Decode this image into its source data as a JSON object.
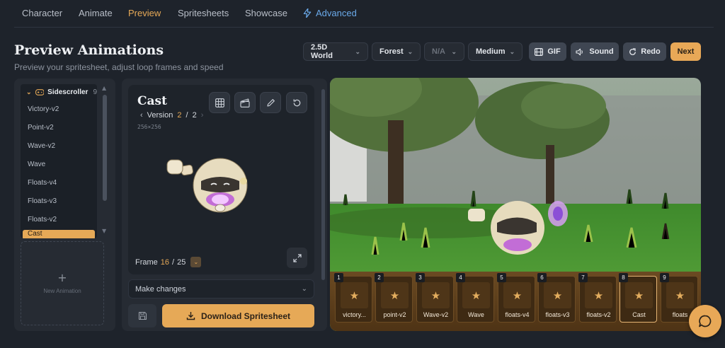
{
  "nav": {
    "tabs": [
      "Character",
      "Animate",
      "Preview",
      "Spritesheets",
      "Showcase"
    ],
    "advanced": "Advanced"
  },
  "page": {
    "title": "Preview Animations",
    "subtitle": "Preview your spritesheet, adjust loop frames and speed"
  },
  "toolbar": {
    "world": "2.5D World",
    "scene": "Forest",
    "option": "N/A",
    "quality": "Medium",
    "gif": "GIF",
    "sound": "Sound",
    "redo": "Redo",
    "next": "Next"
  },
  "sidebar": {
    "group": "Sidescroller",
    "group_count": "9",
    "items": [
      "Victory-v2",
      "Point-v2",
      "Wave-v2",
      "Wave",
      "Floats-v4",
      "Floats-v3",
      "Floats-v2",
      "Cast"
    ],
    "new_animation": "New Animation"
  },
  "preview": {
    "name": "Cast",
    "version_label": "Version",
    "version_current": "2",
    "version_total": "2",
    "size": "256×256",
    "frame_label": "Frame",
    "frame_current": "16",
    "frame_total": "25",
    "make_changes": "Make changes",
    "download": "Download Spritesheet"
  },
  "filmstrip": [
    {
      "index": "1",
      "name": "victory..."
    },
    {
      "index": "2",
      "name": "point-v2"
    },
    {
      "index": "3",
      "name": "Wave-v2"
    },
    {
      "index": "4",
      "name": "Wave"
    },
    {
      "index": "5",
      "name": "floats-v4"
    },
    {
      "index": "6",
      "name": "floats-v3"
    },
    {
      "index": "7",
      "name": "floats-v2"
    },
    {
      "index": "8",
      "name": "Cast"
    },
    {
      "index": "9",
      "name": "floats"
    }
  ],
  "colors": {
    "accent": "#e6a957",
    "link": "#6aa9e9",
    "background": "#1e232b",
    "panel": "#262b33"
  }
}
